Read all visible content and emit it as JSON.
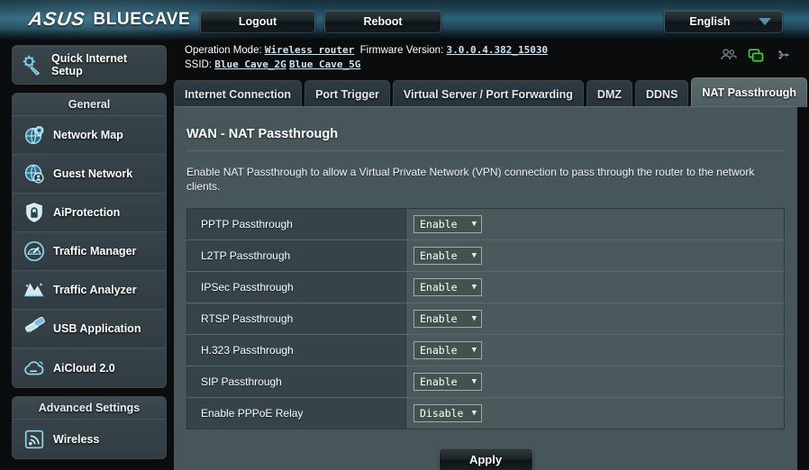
{
  "header": {
    "brand": "/SUS",
    "brand_text": "ASUS",
    "model": "BLUECAVE",
    "logout_label": "Logout",
    "reboot_label": "Reboot",
    "language": "English",
    "accent_blue": "#2b6278"
  },
  "info": {
    "operation_mode_label": "Operation Mode:",
    "operation_mode_value": "Wireless router",
    "firmware_label": "Firmware Version:",
    "firmware_value": "3.0.0.4.382_15030",
    "ssid_label": "SSID:",
    "ssid_2g": "Blue Cave_2G",
    "ssid_5g": "Blue Cave_5G",
    "icons": [
      {
        "name": "clients-icon",
        "color": "#7d8a90"
      },
      {
        "name": "network-monitor-icon",
        "color": "#3ad13a"
      },
      {
        "name": "usb-icon",
        "color": "#7d8a90"
      }
    ]
  },
  "sidebar": {
    "quick_setup": "Quick Internet Setup",
    "general_title": "General",
    "general_items": [
      {
        "label": "Network Map",
        "icon": "network-map-icon"
      },
      {
        "label": "Guest Network",
        "icon": "guest-network-icon"
      },
      {
        "label": "AiProtection",
        "icon": "shield-lock-icon"
      },
      {
        "label": "Traffic Manager",
        "icon": "gauge-icon"
      },
      {
        "label": "Traffic Analyzer",
        "icon": "chart-peaks-icon"
      },
      {
        "label": "USB Application",
        "icon": "usb-application-icon"
      },
      {
        "label": "AiCloud 2.0",
        "icon": "cloud-icon"
      }
    ],
    "advanced_title": "Advanced Settings",
    "advanced_items": [
      {
        "label": "Wireless",
        "icon": "wireless-signal-icon"
      }
    ]
  },
  "tabs": [
    {
      "label": "Internet Connection",
      "active": false
    },
    {
      "label": "Port Trigger",
      "active": false
    },
    {
      "label": "Virtual Server / Port Forwarding",
      "active": false
    },
    {
      "label": "DMZ",
      "active": false
    },
    {
      "label": "DDNS",
      "active": false
    },
    {
      "label": "NAT Passthrough",
      "active": true
    }
  ],
  "main": {
    "title": "WAN - NAT Passthrough",
    "description": "Enable NAT Passthrough to allow a Virtual Private Network (VPN) connection to pass through the router to the network clients.",
    "rows": [
      {
        "label": "PPTP Passthrough",
        "value": "Enable"
      },
      {
        "label": "L2TP Passthrough",
        "value": "Enable"
      },
      {
        "label": "IPSec Passthrough",
        "value": "Enable"
      },
      {
        "label": "RTSP Passthrough",
        "value": "Enable"
      },
      {
        "label": "H.323 Passthrough",
        "value": "Enable"
      },
      {
        "label": "SIP Passthrough",
        "value": "Enable"
      },
      {
        "label": "Enable PPPoE Relay",
        "value": "Disable"
      }
    ],
    "apply_label": "Apply"
  }
}
